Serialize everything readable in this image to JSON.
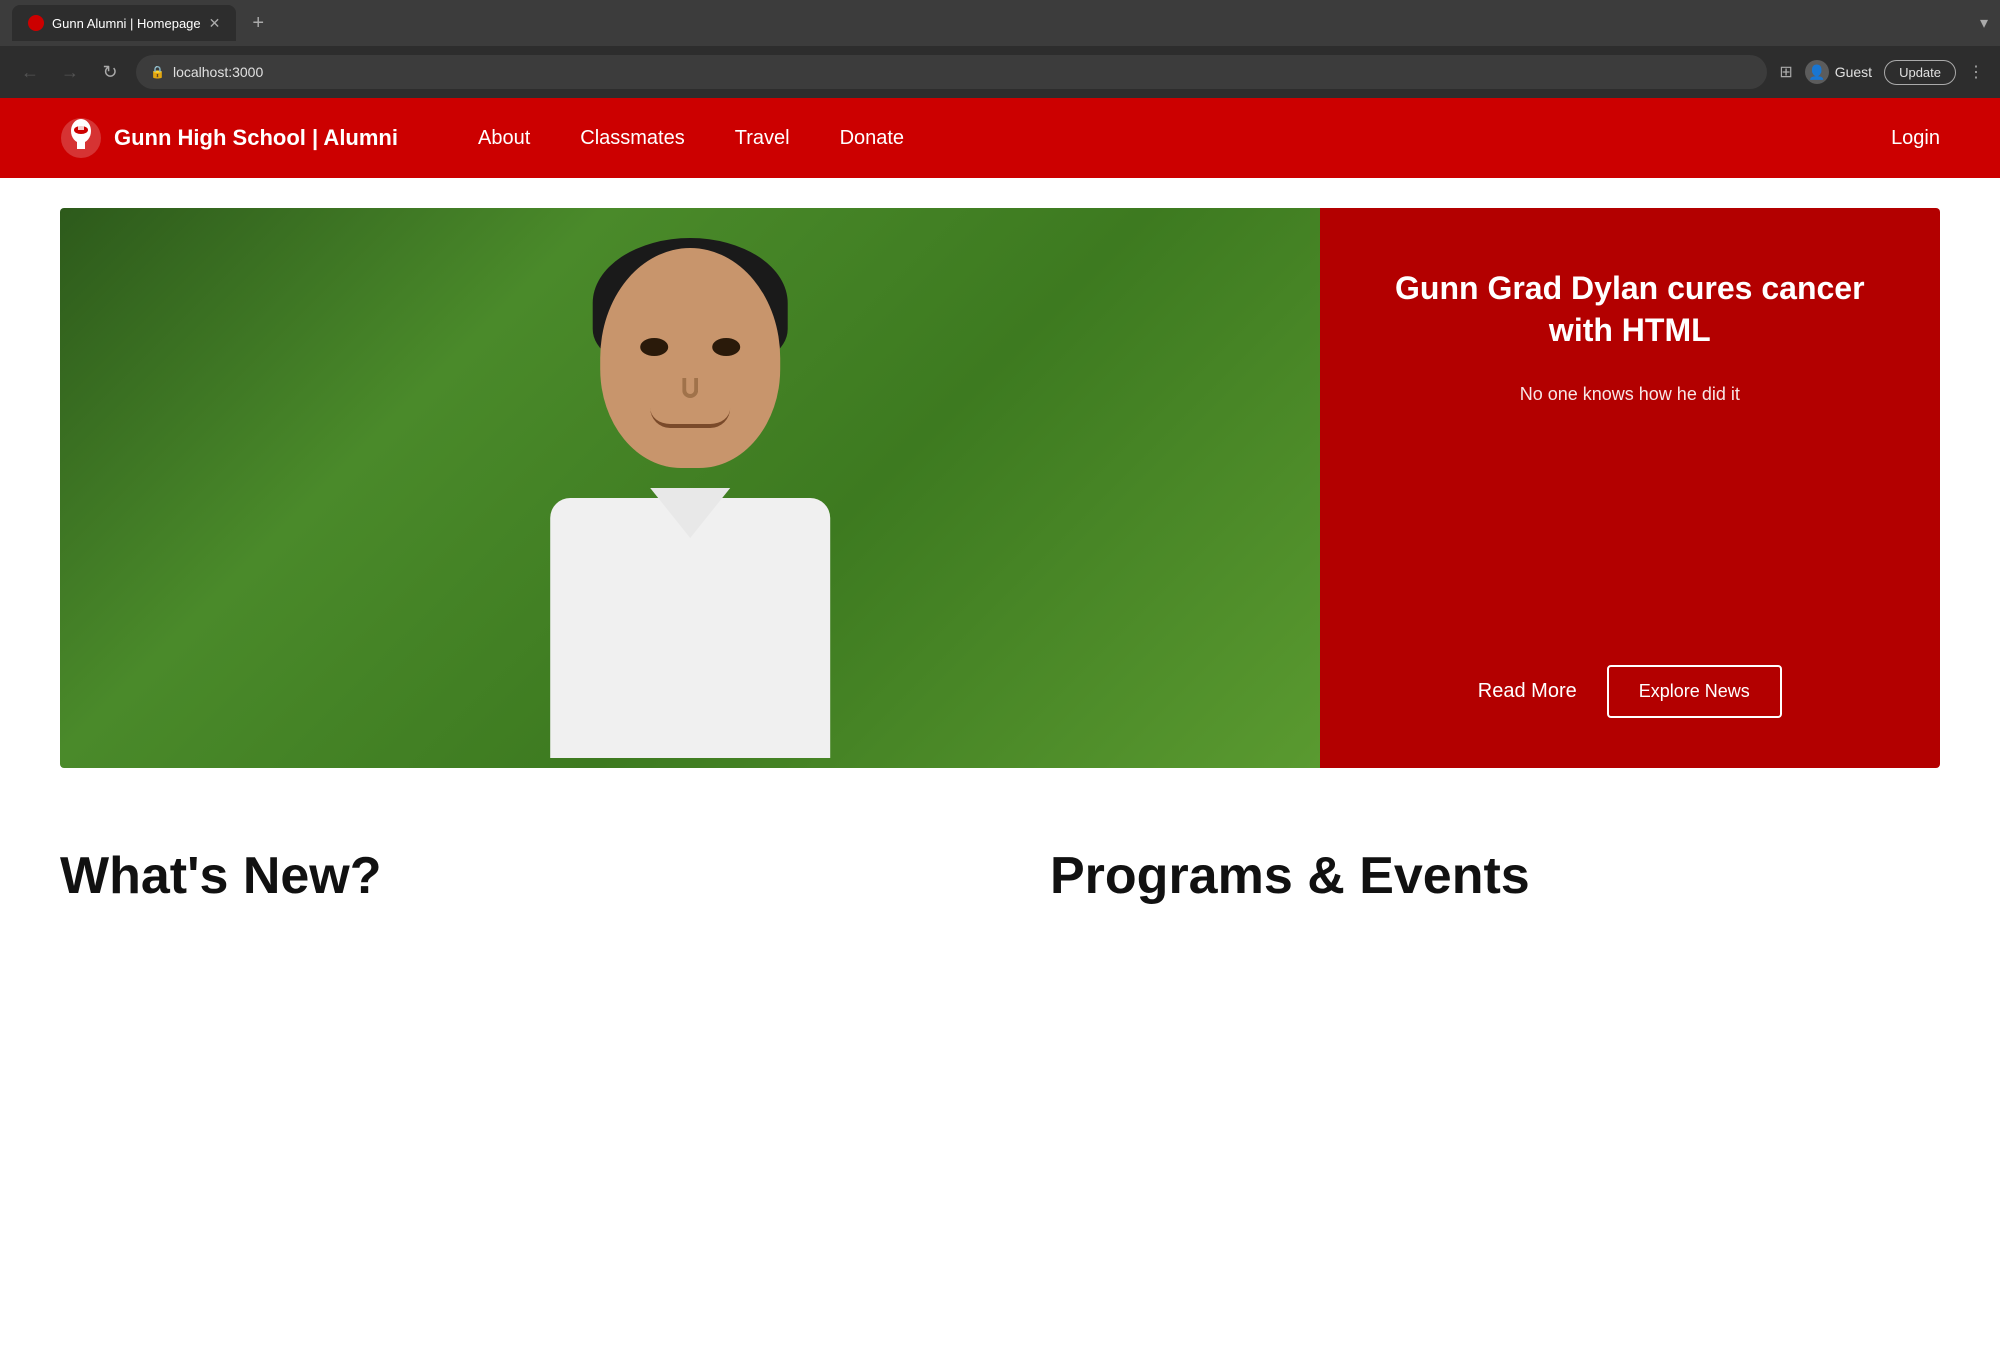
{
  "browser": {
    "tab_title": "Gunn Alumni | Homepage",
    "url": "localhost:3000",
    "new_tab_icon": "+",
    "chevron_icon": "▾",
    "back_icon": "←",
    "forward_icon": "→",
    "reload_icon": "↻",
    "lock_icon": "🔒",
    "grid_icon": "⊞",
    "user_name": "Guest",
    "update_label": "Update",
    "menu_icon": "⋮"
  },
  "navbar": {
    "brand_name": "Gunn High School | Alumni",
    "links": [
      {
        "label": "About",
        "id": "about"
      },
      {
        "label": "Classmates",
        "id": "classmates"
      },
      {
        "label": "Travel",
        "id": "travel"
      },
      {
        "label": "Donate",
        "id": "donate"
      }
    ],
    "login_label": "Login"
  },
  "hero": {
    "title": "Gunn Grad Dylan cures cancer with HTML",
    "subtitle": "No one knows how he did it",
    "read_more_label": "Read More",
    "explore_label": "Explore News"
  },
  "bottom": {
    "col1_heading": "What's New?",
    "col2_heading": "Programs & Events"
  }
}
